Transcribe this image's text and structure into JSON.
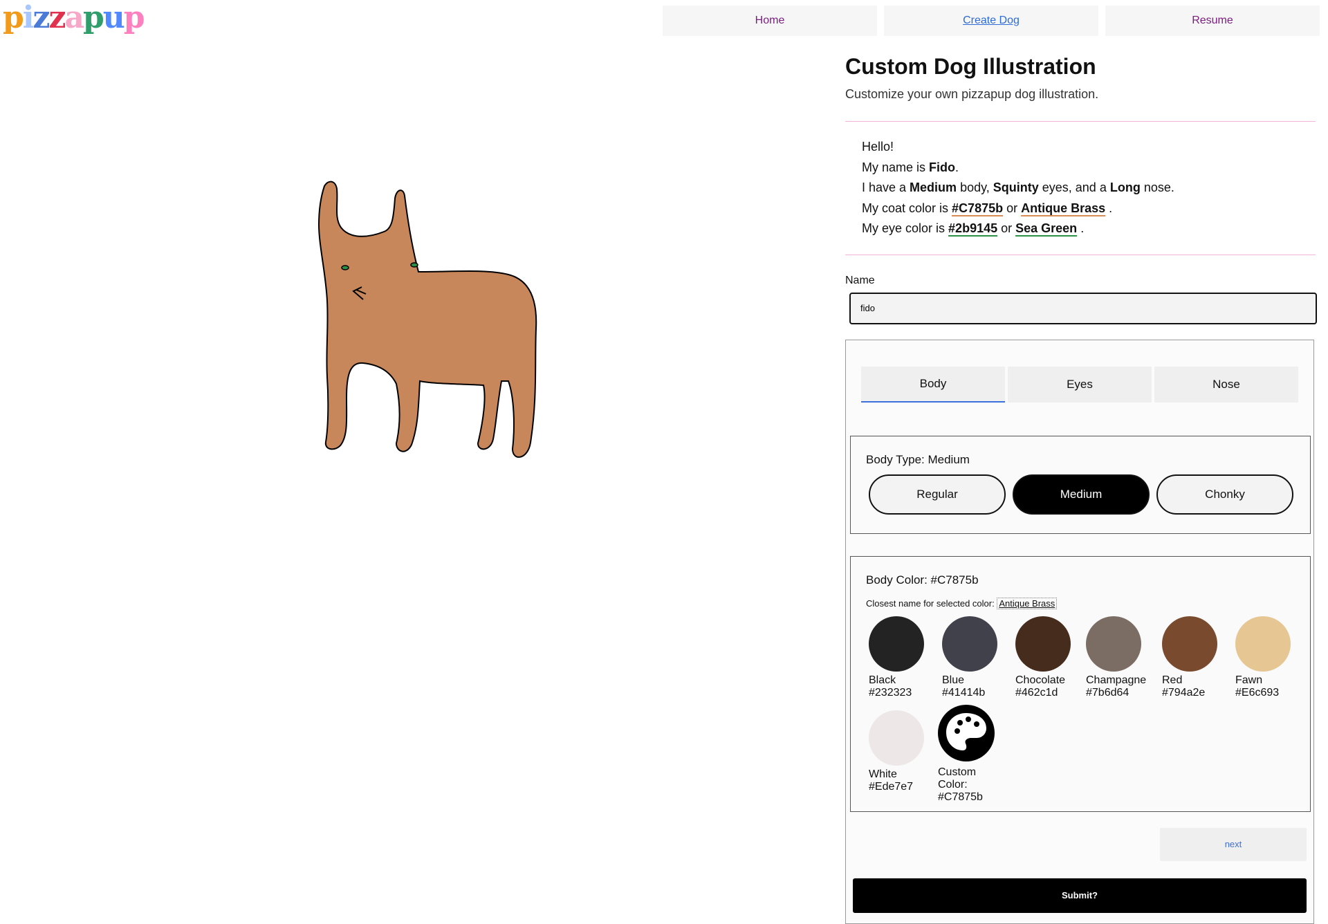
{
  "logo": {
    "letters": [
      "p",
      "i",
      "z",
      "z",
      "a",
      "p",
      "u",
      "p"
    ],
    "colors": [
      "#f29a1a",
      "#a8c7ff",
      "#4a7bd6",
      "#e0314e",
      "#f7a8c8",
      "#2f9e6b",
      "#4f88ff",
      "#ff7fbf"
    ]
  },
  "nav": {
    "items": [
      "Home",
      "Create Dog",
      "Resume"
    ]
  },
  "dog": {
    "body_color": "#C7875b",
    "eye_color": "#2b9145"
  },
  "header": {
    "title": "Custom Dog Illustration",
    "subtitle": "Customize your own pizzapup dog illustration."
  },
  "intro": {
    "hello": "Hello!",
    "name_prefix": "My name is ",
    "name": "Fido",
    "name_suffix": ".",
    "line3_prefix": "I have a ",
    "body_type": "Medium",
    "line3_mid1": " body, ",
    "eye_type": "Squinty",
    "line3_mid2": " eyes, and a ",
    "nose_type": "Long",
    "line3_suffix": " nose.",
    "coat_prefix": "My coat color is ",
    "coat_hex": "#C7875b",
    "or": " or ",
    "coat_name": "Antique Brass",
    "period": " .",
    "eye_prefix": "My eye color is ",
    "eye_hex": "#2b9145",
    "eye_name": "Sea Green"
  },
  "form": {
    "name_label": "Name",
    "name_value": "fido",
    "tabs": [
      "Body",
      "Eyes",
      "Nose"
    ],
    "body_type_title": "Body Type: Medium",
    "body_types": [
      "Regular",
      "Medium",
      "Chonky"
    ],
    "body_color_title": "Body Color: #C7875b",
    "closest_label": "Closest name for selected color:",
    "closest_name": "Antique Brass",
    "swatches": [
      {
        "name": "Black",
        "hex": "#232323",
        "color": "#232323"
      },
      {
        "name": "Blue",
        "hex": "#41414b",
        "color": "#41414b"
      },
      {
        "name": "Chocolate",
        "hex": "#462c1d",
        "color": "#462c1d"
      },
      {
        "name": "Champagne",
        "hex": "#7b6d64",
        "color": "#7b6d64"
      },
      {
        "name": "Red",
        "hex": "#794a2e",
        "color": "#794a2e"
      },
      {
        "name": "Fawn",
        "hex": "#E6c693",
        "color": "#E6c693"
      },
      {
        "name": "White",
        "hex": "#Ede7e7",
        "color": "#Ede7e7"
      }
    ],
    "custom": {
      "line1": "Custom",
      "line2": "Color:",
      "hex": "#C7875b"
    },
    "next_label": "next",
    "submit_label": "Submit?"
  }
}
